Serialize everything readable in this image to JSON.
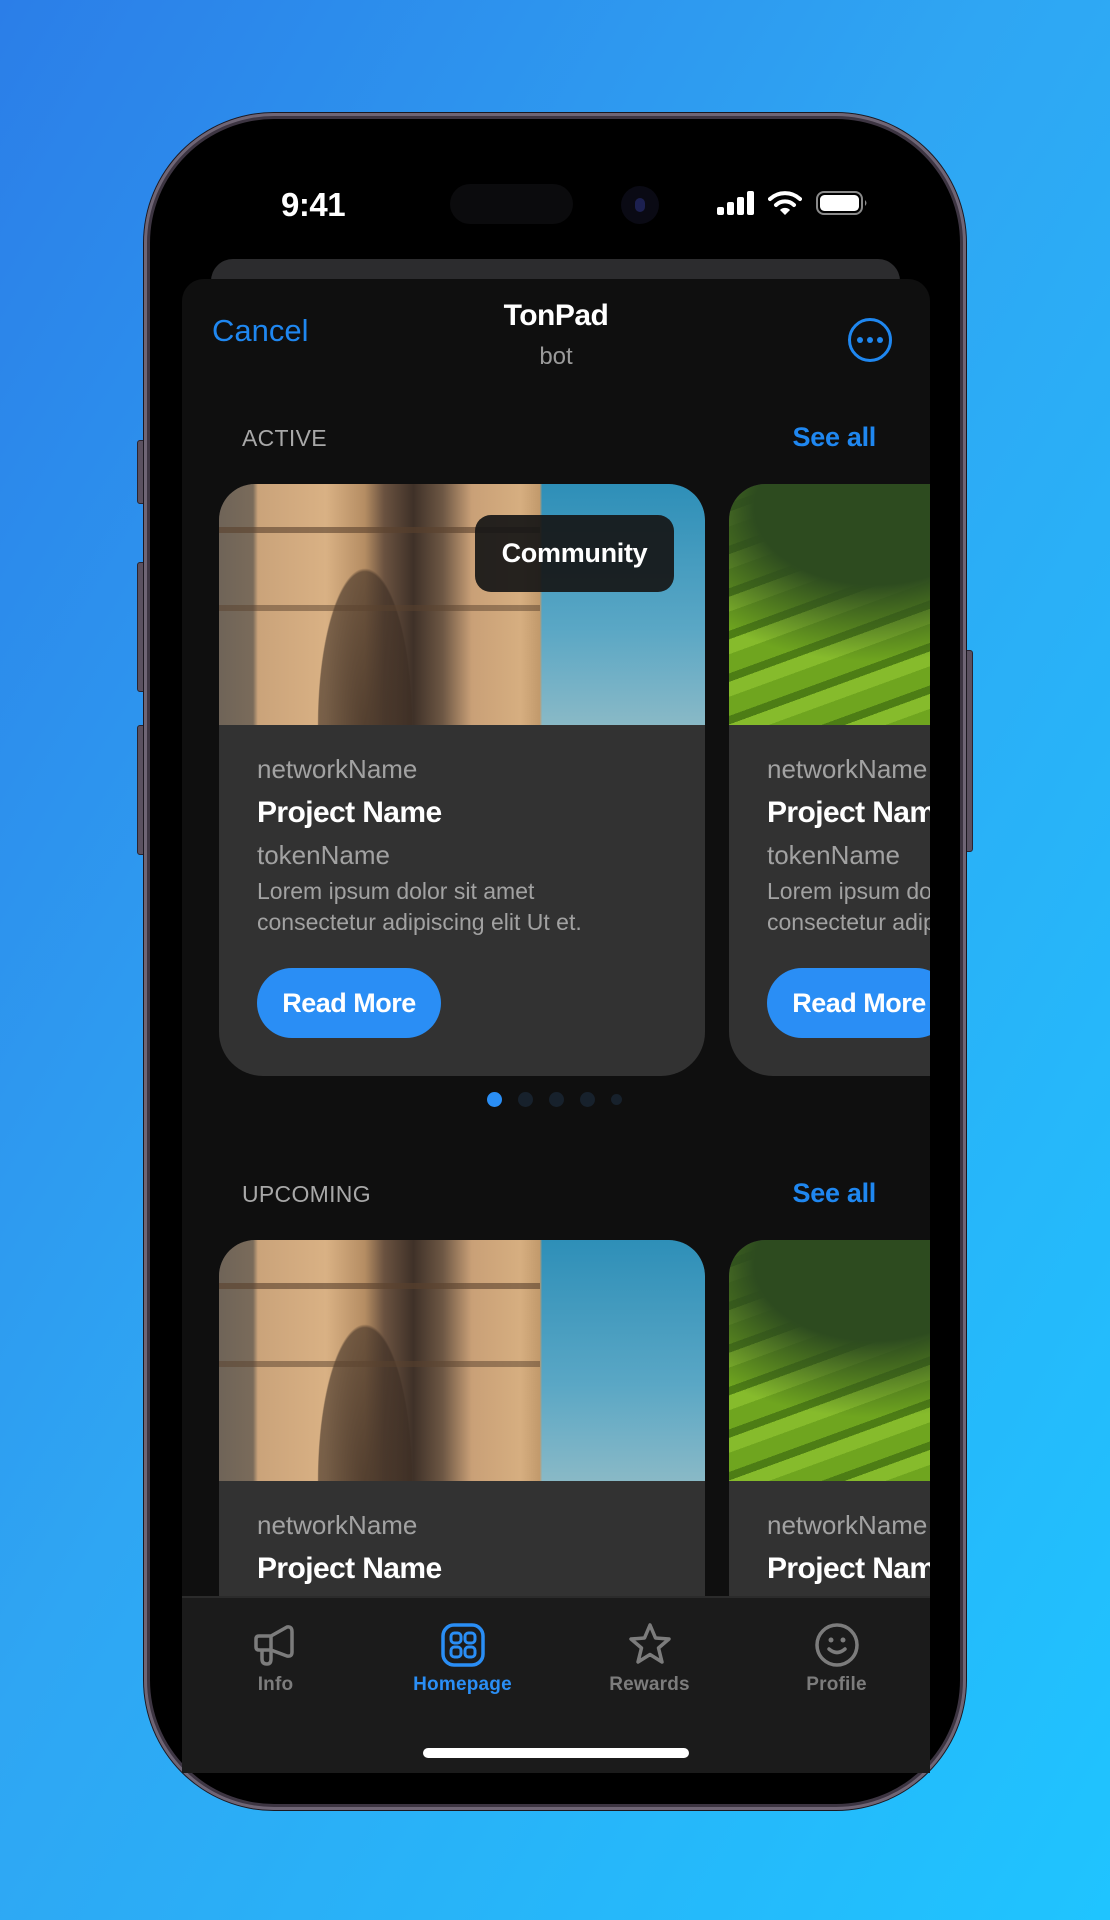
{
  "status_bar": {
    "time": "9:41",
    "icons": [
      "cellular-signal-icon",
      "wifi-icon",
      "battery-icon"
    ]
  },
  "header": {
    "cancel_label": "Cancel",
    "title": "TonPad",
    "subtitle": "bot",
    "more_icon": "ellipsis-circle-icon"
  },
  "colors": {
    "accent": "#2a8ef5",
    "sheet_background": "#0f0f0f",
    "card_background": "#323232",
    "tabbar_background": "#1b1b1b",
    "inactive_tab": "#7c7c7c"
  },
  "sections": [
    {
      "label": "ACTIVE",
      "see_all_label": "See all",
      "cards": [
        {
          "image": "arc-de-triomphe-photo",
          "badge": "Community",
          "network": "networkName",
          "project": "Project Name",
          "token": "tokenName",
          "description_line1": "Lorem ipsum dolor sit amet",
          "description_line2": "consectetur adipiscing elit Ut et.",
          "button_label": "Read More"
        },
        {
          "image": "rice-terraces-photo",
          "network": "networkName",
          "project": "Project Name",
          "token": "tokenName",
          "description_line1": "Lorem ipsum dolor sit amet",
          "description_line2": "consectetur adipiscing elit Ut et.",
          "button_label": "Read More"
        }
      ],
      "pager": {
        "total": 5,
        "active_index": 0
      }
    },
    {
      "label": "UPCOMING",
      "see_all_label": "See all",
      "cards": [
        {
          "image": "arc-de-triomphe-photo",
          "network": "networkName",
          "project": "Project Name"
        },
        {
          "image": "rice-terraces-photo",
          "network": "networkName",
          "project": "Project Name"
        }
      ]
    }
  ],
  "tabbar": {
    "active_index": 1,
    "tabs": [
      {
        "label": "Info",
        "icon": "megaphone-icon"
      },
      {
        "label": "Homepage",
        "icon": "grid-icon"
      },
      {
        "label": "Rewards",
        "icon": "star-icon"
      },
      {
        "label": "Profile",
        "icon": "smiley-icon"
      }
    ]
  }
}
